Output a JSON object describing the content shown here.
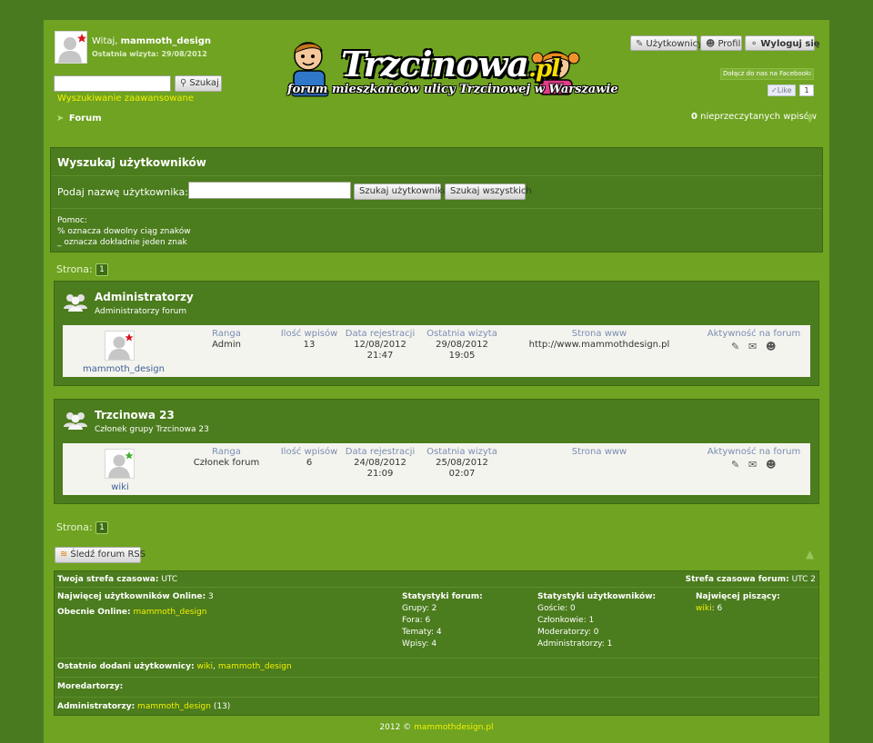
{
  "header": {
    "greeting_prefix": "Witaj,",
    "username": "mammoth_design",
    "last_visit": "Ostatnia wizyta: 29/08/2012",
    "search_button": "Szukaj",
    "advanced_search": "Wyszukiwanie zaawansowane",
    "logo_title": "Trzcinowa",
    "logo_tld": ".pl",
    "logo_subtitle": "forum mieszkańców ulicy Trzcinowej  w Warszawie",
    "users_button": "Użytkownicy",
    "profile_button": "Profil",
    "logout_button": "Wyloguj się",
    "facebook_join": "Dołącz do nas na Facebookı",
    "like_label": "Like",
    "like_count": "1",
    "breadcrumb": "Forum",
    "unread_count": "0",
    "unread_label": "nieprzeczytanych wpisów"
  },
  "search_panel": {
    "title": "Wyszukaj użytkowników",
    "label": "Podaj nazwę użytkownika:",
    "search_user_button": "Szukaj użytkownika",
    "search_all_button": "Szukaj wszystkich",
    "help_title": "Pomoc:",
    "help_line1": "% oznacza dowolny ciąg znaków",
    "help_line2": "_ oznacza dokładnie jeden znak"
  },
  "pagination": {
    "label": "Strona:",
    "current": "1"
  },
  "columns": {
    "rank": "Ranga",
    "posts": "Ilość wpisów",
    "registered": "Data rejestracji",
    "last_visit": "Ostatnia wizyta",
    "website": "Strona www",
    "activity": "Aktywność na forum"
  },
  "groups": [
    {
      "name": "Administratorzy",
      "description": "Administratorzy forum",
      "member": {
        "name": "mammoth_design",
        "rank": "Admin",
        "posts": "13",
        "reg_date": "12/08/2012",
        "reg_time": "21:47",
        "last_date": "29/08/2012",
        "last_time": "19:05",
        "website": "http://www.mammothdesign.pl",
        "star_color": "#d9161f"
      }
    },
    {
      "name": "Trzcinowa 23",
      "description": "Członek grupy Trzcinowa 23",
      "member": {
        "name": "wiki",
        "rank": "Członek forum",
        "posts": "6",
        "reg_date": "24/08/2012",
        "reg_time": "21:09",
        "last_date": "25/08/2012",
        "last_time": "02:07",
        "website": "",
        "star_color": "#3fae2a"
      }
    }
  ],
  "rss_button": "Śledź forum RSS",
  "stats": {
    "timezone_label": "Twoja strefa czasowa:",
    "timezone_value": "UTC",
    "forum_tz_label": "Strefa czasowa forum:",
    "forum_tz_value": "UTC 2",
    "most_online_label": "Najwięcej użytkowników Online:",
    "most_online_value": "3",
    "online_label": "Obecnie Online:",
    "online_value": "mammoth_design",
    "forum_stats_title": "Statystyki forum:",
    "forum_stats": [
      "Grupy: 2",
      "Fora: 6",
      "Tematy: 4",
      "Wpisy: 4"
    ],
    "user_stats_title": "Statystyki użytkowników:",
    "user_stats": [
      "Goście: 0",
      "Członkowie: 1",
      "Moderatorzy: 0",
      "Administratorzy: 1"
    ],
    "top_posters_title": "Najwięcej piszący:",
    "top_poster_name": "wiki",
    "top_poster_count": ": 6",
    "recent_users_label": "Ostatnio dodani użytkownicy:",
    "recent_user1": "wiki",
    "recent_sep": ",",
    "recent_user2": "mammoth_design",
    "moderators_label": "Moredartorzy:",
    "admins_label": "Administratorzy:",
    "admins_value": "mammoth_design",
    "admins_count": "(13)"
  },
  "footer": {
    "year": "2012 ©",
    "link": "mammothdesign.pl"
  },
  "colors": {
    "page_bg": "#6fa321",
    "outer_bg": "#4a7a1f",
    "panel_bg": "#4b7c1d",
    "link_yellow": "#f3f000",
    "header_blue": "#7b8db5"
  }
}
